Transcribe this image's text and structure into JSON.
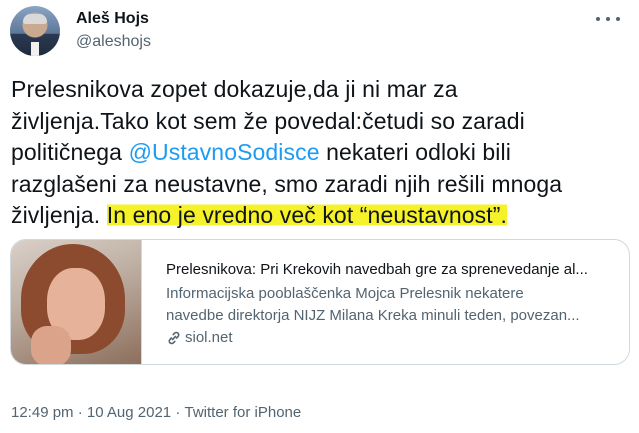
{
  "author": {
    "name": "Aleš Hojs",
    "handle": "@aleshojs"
  },
  "tweet": {
    "line1": "Prelesnikova zopet dokazuje,da ji ni mar za",
    "line2": "življenja.Tako kot sem že povedal:četudi so zaradi",
    "line3_before": "političnega ",
    "mention": "@UstavnoSodisce",
    "line3_after": " nekateri odloki bili",
    "line4": "razglašeni za neustavne, smo zaradi njih rešili mnoga",
    "line5_before": "življenja. ",
    "highlighted": "In eno je vredno več kot “neustavnost”."
  },
  "card": {
    "title": "Prelesnikova: Pri Krekovih navedbah gre za sprenevedanje al...",
    "desc_line1": "Informacijska pooblaščenka Mojca Prelesnik nekatere",
    "desc_line2": "navedbe direktorja NIJZ Milana Kreka minuli teden, povezan...",
    "domain": "siol.net"
  },
  "meta": {
    "time": "12:49 pm",
    "separator": " · ",
    "date": "10 Aug 2021",
    "source": "Twitter for iPhone"
  },
  "colors": {
    "link": "#1d9bf0",
    "highlight": "#f6f22a",
    "secondary_text": "#536471"
  }
}
